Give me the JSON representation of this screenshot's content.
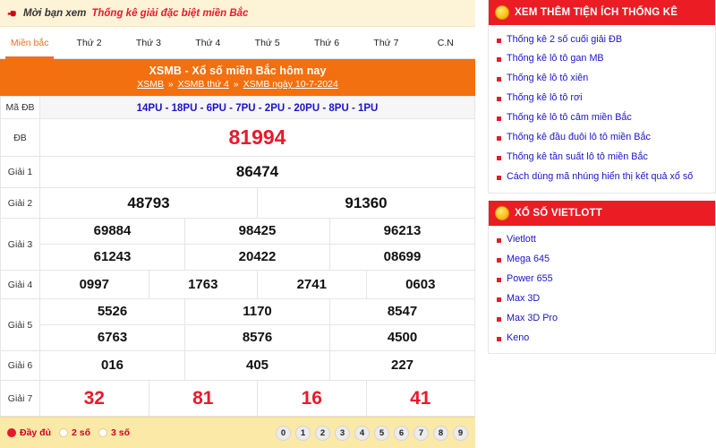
{
  "promo": {
    "icon": "pointing-hand-icon",
    "text": "Mời bạn xem",
    "link": "Thống kê giải đặc biệt miền Bắc"
  },
  "tabs": [
    {
      "label": "Miền bắc",
      "active": true
    },
    {
      "label": "Thứ 2",
      "active": false
    },
    {
      "label": "Thứ 3",
      "active": false
    },
    {
      "label": "Thứ 4",
      "active": false
    },
    {
      "label": "Thứ 5",
      "active": false
    },
    {
      "label": "Thứ 6",
      "active": false
    },
    {
      "label": "Thứ 7",
      "active": false
    },
    {
      "label": "C.N",
      "active": false
    }
  ],
  "result_header": {
    "title": "XSMB - Xổ số miền Bắc hôm nay",
    "breadcrumb": [
      {
        "label": "XSMB"
      },
      {
        "label": "XSMB thứ 4"
      },
      {
        "label": "XSMB ngày 10-7-2024"
      }
    ],
    "separator": "»"
  },
  "table": {
    "ma_db_label": "Mã ĐB",
    "ma_db_value": "14PU - 18PU - 6PU - 7PU - 2PU - 20PU - 8PU - 1PU",
    "rows": [
      {
        "label": "ĐB",
        "numbers": [
          "81994"
        ]
      },
      {
        "label": "Giải 1",
        "numbers": [
          "86474"
        ]
      },
      {
        "label": "Giải 2",
        "numbers": [
          "48793",
          "91360"
        ]
      },
      {
        "label": "Giải 3",
        "numbers": [
          "69884",
          "98425",
          "96213",
          "61243",
          "20422",
          "08699"
        ]
      },
      {
        "label": "Giải 4",
        "numbers": [
          "0997",
          "1763",
          "2741",
          "0603"
        ]
      },
      {
        "label": "Giải 5",
        "numbers": [
          "5526",
          "1170",
          "8547",
          "6763",
          "8576",
          "4500"
        ]
      },
      {
        "label": "Giải 6",
        "numbers": [
          "016",
          "405",
          "227"
        ]
      },
      {
        "label": "Giải 7",
        "numbers": [
          "32",
          "81",
          "16",
          "41"
        ]
      }
    ]
  },
  "footer": {
    "options": [
      {
        "label": "Đầy đủ",
        "selected": true
      },
      {
        "label": "2 số",
        "selected": false
      },
      {
        "label": "3 số",
        "selected": false
      }
    ],
    "digits": [
      "0",
      "1",
      "2",
      "3",
      "4",
      "5",
      "6",
      "7",
      "8",
      "9"
    ]
  },
  "sidebar": {
    "panels": [
      {
        "title": "XEM THÊM TIỆN ÍCH THỐNG KÊ",
        "icon": "coin-icon",
        "links": [
          "Thống kê 2 số cuối giải ĐB",
          "Thống kê lô tô gan MB",
          "Thống kê lô tô xiên",
          "Thống kê lô tô rơi",
          "Thống kê lô tô câm miền Bắc",
          "Thống kê đầu đuôi lô tô miền Bắc",
          "Thống kê tần suất lô tô miền Bắc",
          "Cách dùng mã nhúng hiển thị kết quả xổ số"
        ]
      },
      {
        "title": "XỔ SỐ VIETLOTT",
        "icon": "coin-icon",
        "links": [
          "Vietlott",
          "Mega 645",
          "Power 655",
          "Max 3D",
          "Max 3D Pro",
          "Keno"
        ]
      }
    ]
  },
  "colors": {
    "orange": "#f2700f",
    "red": "#e8192c",
    "panel_red": "#ec1c24",
    "blue_link": "#1b14c9",
    "promo_bg": "#fdf4d8",
    "footer_bg": "#fbe9a8"
  }
}
